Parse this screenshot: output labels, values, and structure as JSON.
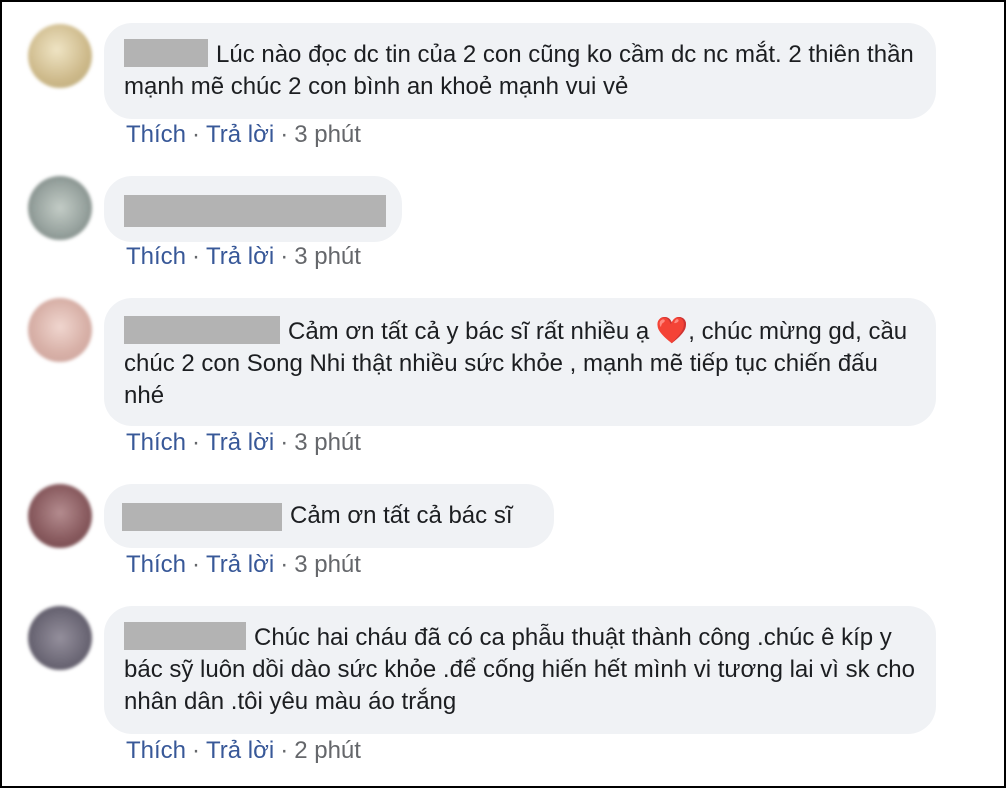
{
  "comments": [
    {
      "text": "Lúc nào đọc dc tin của 2 con cũng ko cầm dc nc mắt. 2 thiên thần mạnh mẽ chúc 2 con bình an khoẻ mạnh vui vẻ",
      "like_label": "Thích",
      "reply_label": "Trả lời",
      "time": "3 phút",
      "avatar_color": "#d8c79e"
    },
    {
      "text": "",
      "like_label": "Thích",
      "reply_label": "Trả lời",
      "time": "3 phút",
      "avatar_color": "#9aa6a2"
    },
    {
      "text_before_icon": "Cảm ơn tất cả y bác sĩ rất nhiều ạ",
      "icon": "heart-icon",
      "text_after_icon": ", chúc mừng gd, cầu chúc 2 con Song Nhi thật nhiều sức khỏe , mạnh mẽ tiếp tục chiến đấu nhé",
      "like_label": "Thích",
      "reply_label": "Trả lời",
      "time": "3 phút",
      "avatar_color": "#d9b6b0"
    },
    {
      "text": "Cảm ơn tất cả bác sĩ",
      "like_label": "Thích",
      "reply_label": "Trả lời",
      "time": "3 phút",
      "avatar_color": "#8c5a5e"
    },
    {
      "text": "Chúc hai cháu đã có ca phẫu thuật thành công .chúc ê kíp y bác sỹ luôn dồi dào sức khỏe .để cống hiến hết mình vi tương lai vì sk cho nhân dân .tôi yêu màu áo trắng",
      "like_label": "Thích",
      "reply_label": "Trả lời",
      "time": "2 phút",
      "avatar_color": "#6e6a78"
    }
  ],
  "separator": "·",
  "colors": {
    "bubble_bg": "#f0f2f5",
    "link": "#385898",
    "meta": "#65676b",
    "redaction": "#b3b3b3"
  }
}
